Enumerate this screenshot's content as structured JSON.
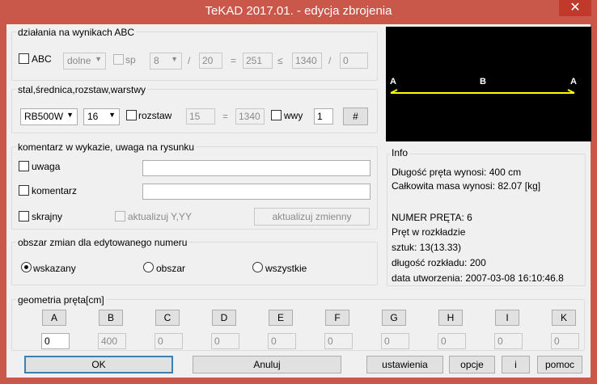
{
  "window": {
    "title": "TeKAD 2017.01. - edycja zbrojenia",
    "close_glyph": "✕"
  },
  "abc": {
    "legend": "działania na wynikach ABC",
    "abc_label": "ABC",
    "position_select": "dolne",
    "sp_label": "sp",
    "number_select": "8",
    "op1": "/",
    "value1": "20",
    "op2": "=",
    "value2": "251",
    "op3": "≤",
    "value3": "1340",
    "op4": "/",
    "value4": "0"
  },
  "steel": {
    "legend": "stal,średnica,rozstaw,warstwy",
    "grade": "RB500W",
    "diameter": "16",
    "rozstaw_label": "rozstaw",
    "spacing": "15",
    "eq": "=",
    "length": "1340",
    "wwy_label": "wwy",
    "layers": "1",
    "hash_button": "#"
  },
  "comment": {
    "legend": "komentarz w wykazie, uwaga na rysunku",
    "uwaga_label": "uwaga",
    "uwaga_value": "",
    "komentarz_label": "komentarz",
    "komentarz_value": "",
    "skrajny_label": "skrajny",
    "aktualizuj_label": "aktualizuj Y,YY",
    "aktualizuj_zmienny": "aktualizuj zmienny"
  },
  "scope": {
    "legend": "obszar zmian dla edytowanego numeru",
    "options": [
      "wskazany",
      "obszar",
      "wszystkie"
    ],
    "selected": "wskazany"
  },
  "preview": {
    "labels": [
      "A",
      "B",
      "A"
    ],
    "line_color": "#ffff00",
    "background": "#000000"
  },
  "info": {
    "legend": "Info",
    "length_line": "Długość pręta wynosi: 400 cm",
    "mass_line": "Całkowita masa wynosi: 82.07 [kg]",
    "number_line": "NUMER PRĘTA: 6",
    "rozklad_line": "Pręt w rozkładzie",
    "count_line": "sztuk: 13(13.33)",
    "rozklad_len_line": "długość rozkładu: 200",
    "created_line": "data utworzenia:   2007-03-08 16:10:46.8"
  },
  "geometry": {
    "legend": "geometria pręta[cm]",
    "columns": [
      {
        "label": "A",
        "value": "0"
      },
      {
        "label": "B",
        "value": "400"
      },
      {
        "label": "C",
        "value": "0"
      },
      {
        "label": "D",
        "value": "0"
      },
      {
        "label": "E",
        "value": "0"
      },
      {
        "label": "F",
        "value": "0"
      },
      {
        "label": "G",
        "value": "0"
      },
      {
        "label": "H",
        "value": "0"
      },
      {
        "label": "I",
        "value": "0"
      },
      {
        "label": "K",
        "value": "0"
      }
    ]
  },
  "footer": {
    "ok": "OK",
    "cancel": "Anuluj",
    "settings": "ustawienia",
    "options": "opcje",
    "info": "i",
    "help": "pomoc"
  }
}
